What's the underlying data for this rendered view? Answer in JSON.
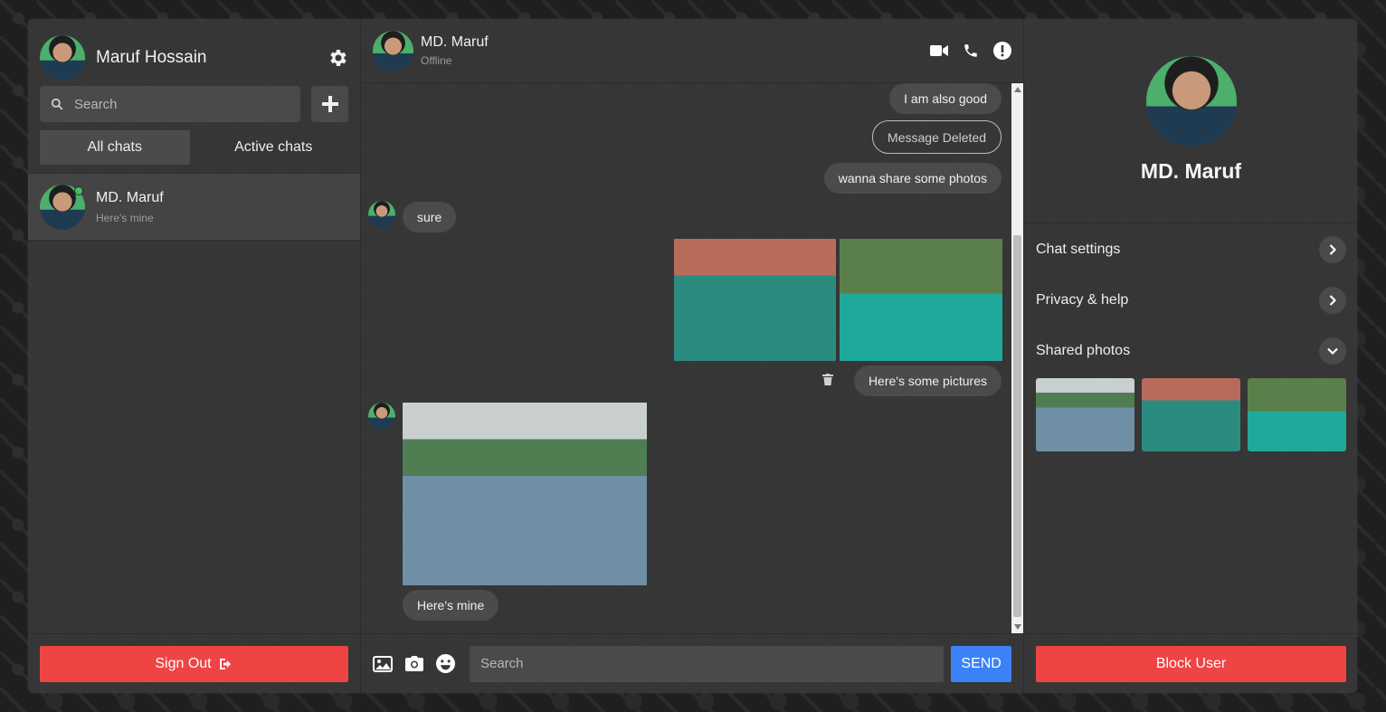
{
  "colors": {
    "accent_red": "#ef4444",
    "send_blue": "#3b82f6",
    "online": "#3fbf5f"
  },
  "sidebar": {
    "user_name": "Maruf Hossain",
    "search_placeholder": "Search",
    "tabs": [
      {
        "label": "All chats",
        "active": true
      },
      {
        "label": "Active chats",
        "active": false
      }
    ],
    "chats": [
      {
        "name": "MD. Maruf",
        "preview": "Here's mine",
        "online": true
      }
    ],
    "sign_out_label": "Sign Out"
  },
  "chat": {
    "contact_name": "MD. Maruf",
    "status": "Offline",
    "messages": {
      "m1": "I am also good",
      "m2": "Message Deleted",
      "m3": "wanna share some photos",
      "m4": "sure",
      "m5": "Here's some pictures",
      "m6": "Here's mine"
    },
    "input_placeholder": "Search",
    "send_label": "SEND"
  },
  "details": {
    "name": "MD. Maruf",
    "options": [
      "Chat settings",
      "Privacy & help",
      "Shared photos"
    ],
    "block_label": "Block User"
  }
}
